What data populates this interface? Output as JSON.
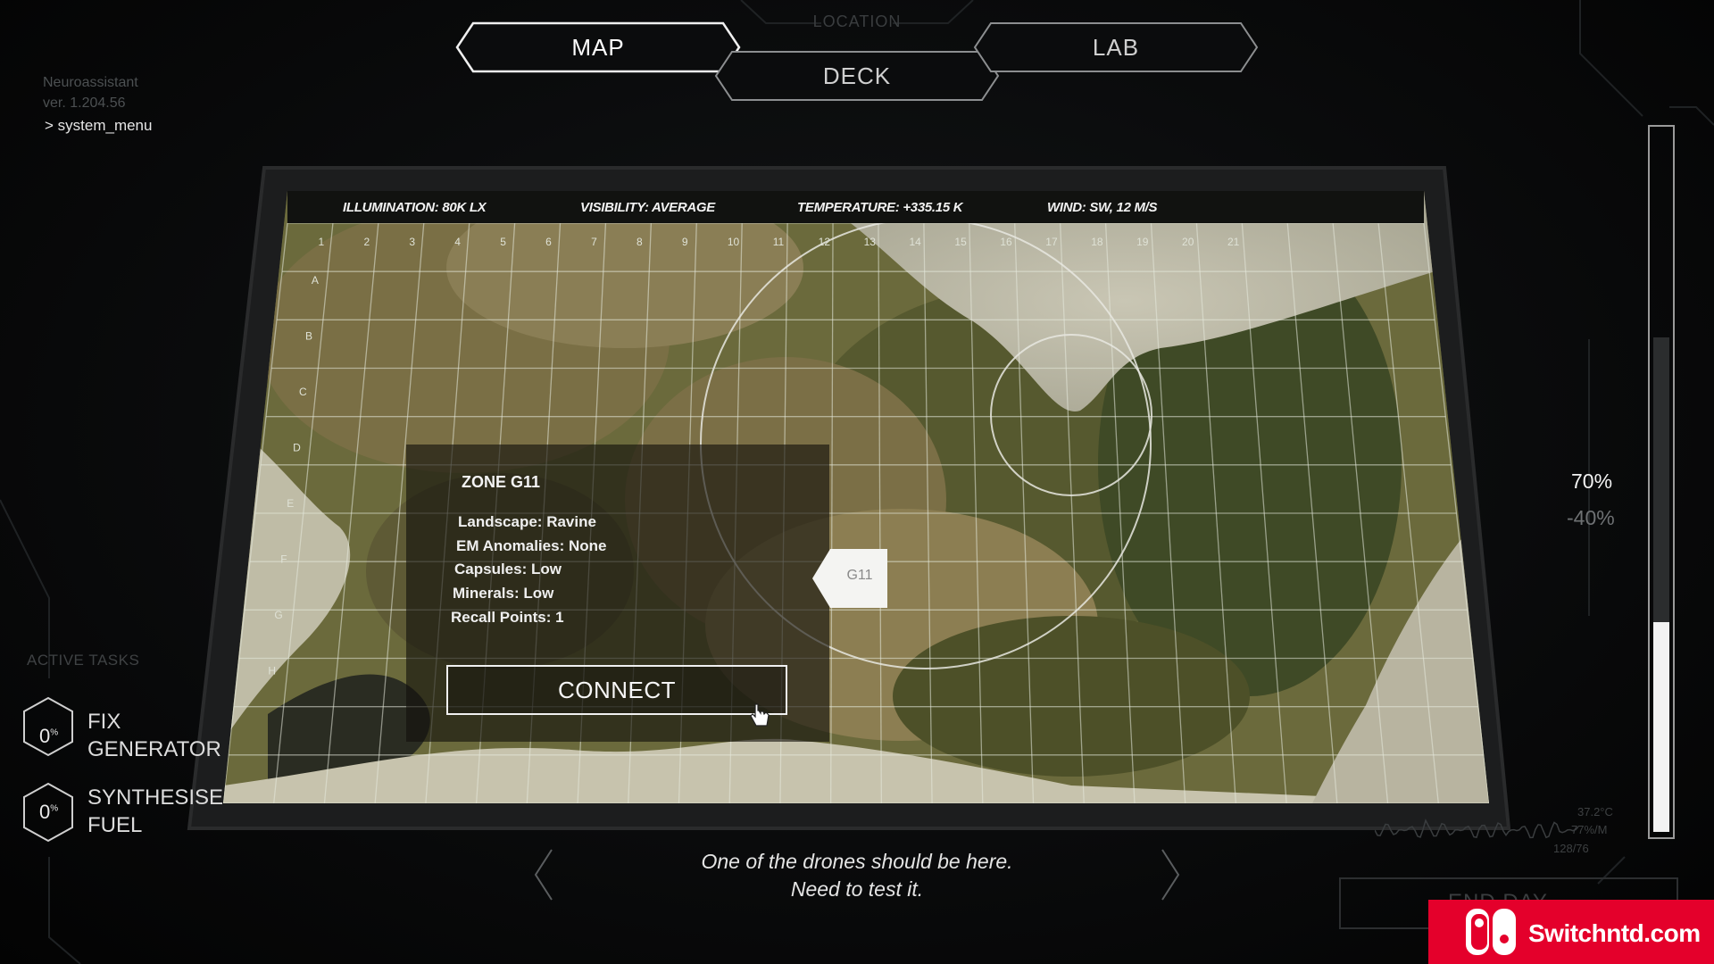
{
  "nav": {
    "location_label": "LOCATION",
    "tabs": [
      {
        "label": "MAP",
        "active": true
      },
      {
        "label": "DECK",
        "active": false
      },
      {
        "label": "LAB",
        "active": false
      }
    ]
  },
  "system": {
    "name": "Neuroassistant",
    "version": "ver. 1.204.56",
    "menu_link": "> system_menu"
  },
  "map": {
    "stats": {
      "illumination": "ILLUMINATION: 80K LX",
      "visibility": "VISIBILITY: AVERAGE",
      "temperature": "TEMPERATURE: +335.15 K",
      "wind": "WIND: SW, 12 M/S"
    },
    "col_labels": [
      "1",
      "2",
      "3",
      "4",
      "5",
      "6",
      "7",
      "8",
      "9",
      "10",
      "11",
      "12",
      "13",
      "14",
      "15",
      "16",
      "17",
      "18",
      "19",
      "20",
      "21"
    ],
    "row_labels": [
      "A",
      "B",
      "C",
      "D",
      "E",
      "F",
      "G",
      "H"
    ],
    "marker_label": "G11"
  },
  "zone": {
    "title": "ZONE G11",
    "details": [
      "Landscape: Ravine",
      "EM Anomalies: None",
      "Capsules: Low",
      "Minerals: Low",
      "Recall Points: 1"
    ],
    "connect_label": "CONNECT"
  },
  "slider": {
    "value_label": "70%",
    "delta_label": "-40%",
    "level": 0.3
  },
  "tasks": {
    "heading": "ACTIVE TASKS",
    "items": [
      {
        "progress": "0",
        "unit": "%",
        "line1": "FIX",
        "line2": "GENERATOR"
      },
      {
        "progress": "0",
        "unit": "%",
        "line1": "SYNTHESISE",
        "line2": "FUEL"
      }
    ]
  },
  "dialogue": {
    "line1": "One of the drones should be here.",
    "line2": "Need to test it."
  },
  "bottom_right": {
    "end_day_label": "END DAY",
    "readouts": [
      "37.2°C",
      "77%/M",
      "128/76"
    ]
  },
  "watermark": {
    "text": "Switchntd.com"
  },
  "icons": {
    "cursor": "hand-pointer-icon",
    "arrow_left": "chevron-left-icon",
    "arrow_right": "chevron-right-icon"
  },
  "colors": {
    "background": "#050607",
    "accent": "#f2f2f2",
    "dim_text": "#4c5052",
    "watermark_red": "#e4002b"
  }
}
